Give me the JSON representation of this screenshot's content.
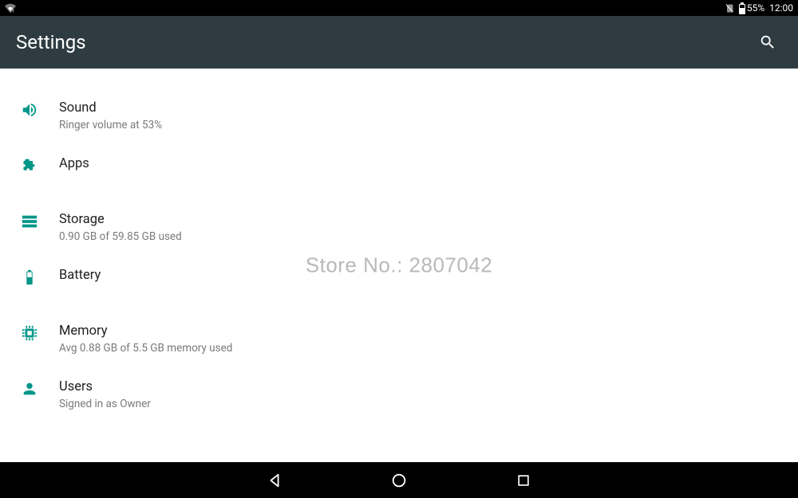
{
  "status": {
    "battery_pct": "55%",
    "time": "12:00",
    "battery_fill_pct": 55
  },
  "header": {
    "title": "Settings"
  },
  "rows": {
    "sound": {
      "title": "Sound",
      "sub": "Ringer volume at 53%"
    },
    "apps": {
      "title": "Apps"
    },
    "storage": {
      "title": "Storage",
      "sub": "0.90 GB of 59.85 GB used"
    },
    "battery": {
      "title": "Battery"
    },
    "memory": {
      "title": "Memory",
      "sub": "Avg 0.88 GB of 5.5 GB memory used"
    },
    "users": {
      "title": "Users",
      "sub": "Signed in as Owner"
    }
  },
  "watermark": "Store No.: 2807042"
}
